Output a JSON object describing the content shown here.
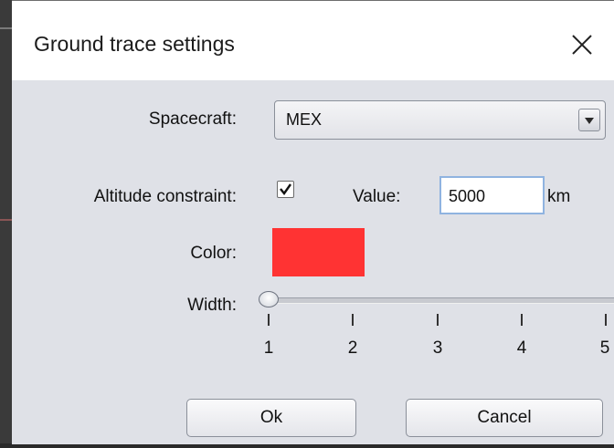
{
  "window": {
    "title": "Ground trace settings"
  },
  "form": {
    "spacecraft_label": "Spacecraft:",
    "spacecraft_value": "MEX",
    "altitude_label": "Altitude constraint:",
    "altitude_checked": true,
    "value_label": "Value:",
    "value": "5000",
    "unit": "km",
    "color_label": "Color:",
    "color": "#ff3333",
    "width_label": "Width:",
    "width_ticks": [
      "1",
      "2",
      "3",
      "4",
      "5"
    ],
    "width_value": 1
  },
  "buttons": {
    "ok": "Ok",
    "cancel": "Cancel"
  },
  "icons": {
    "close": "close-icon",
    "dropdown": "chevron-down-icon",
    "check": "check-icon"
  }
}
